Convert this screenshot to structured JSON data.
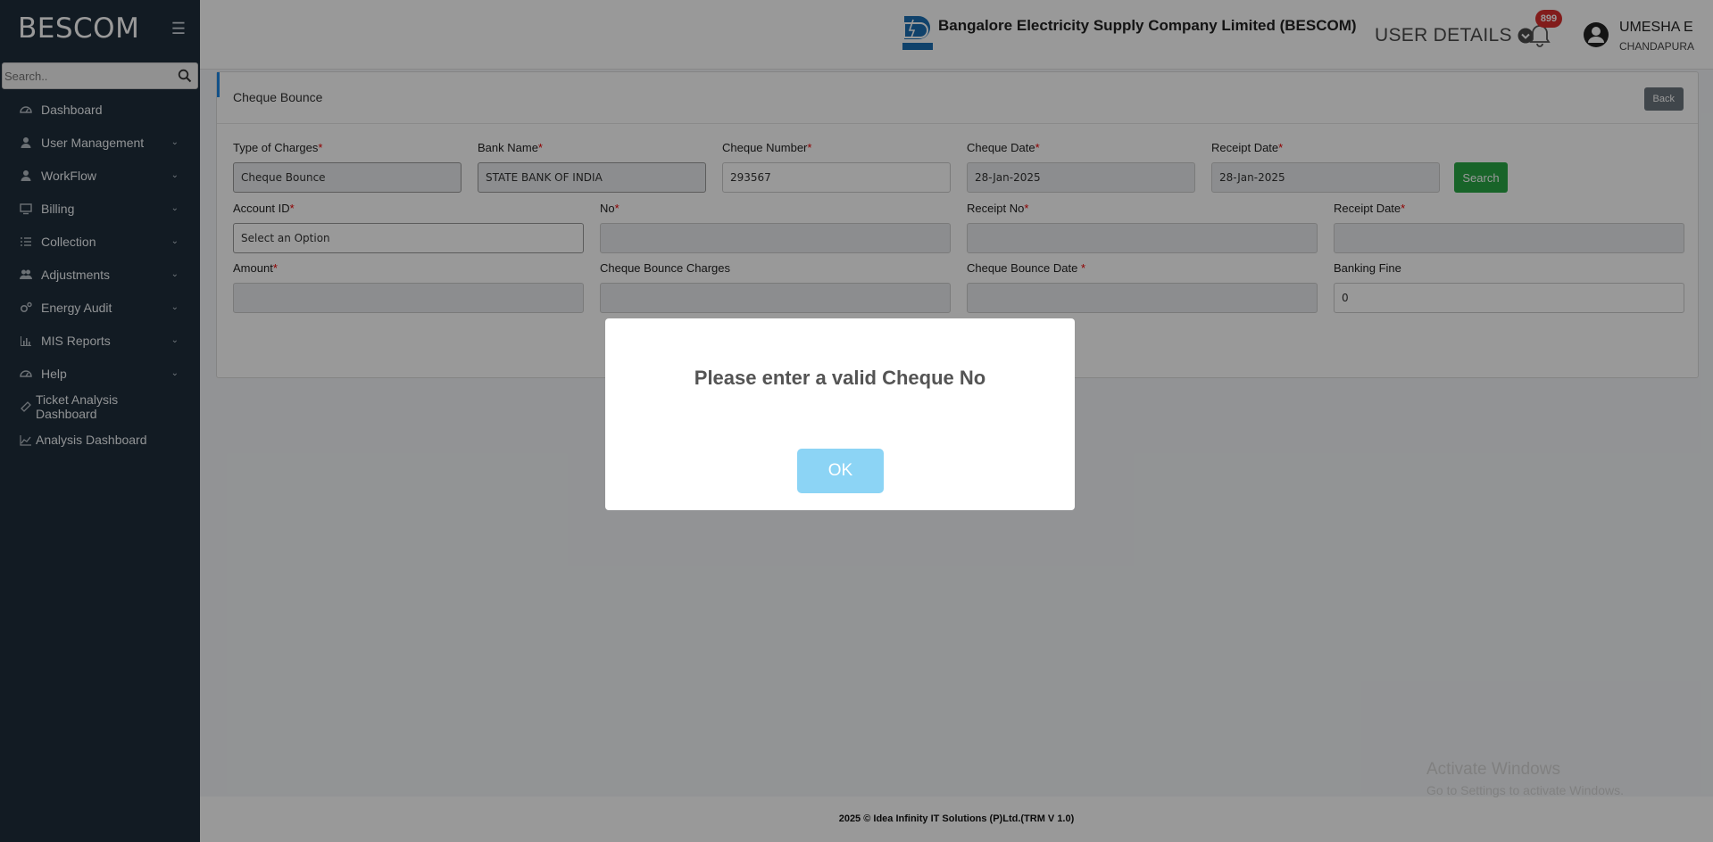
{
  "sidebar": {
    "brand": "BESCOM",
    "search_placeholder": "Search..",
    "items": [
      {
        "label": "Dashboard",
        "icon": "dashboard-icon",
        "has_children": false
      },
      {
        "label": "User Management",
        "icon": "user-icon",
        "has_children": true
      },
      {
        "label": "WorkFlow",
        "icon": "user-icon",
        "has_children": true
      },
      {
        "label": "Billing",
        "icon": "monitor-icon",
        "has_children": true
      },
      {
        "label": "Collection",
        "icon": "list-icon",
        "has_children": true
      },
      {
        "label": "Adjustments",
        "icon": "users-icon",
        "has_children": true
      },
      {
        "label": "Energy Audit",
        "icon": "gears-icon",
        "has_children": true
      },
      {
        "label": "MIS Reports",
        "icon": "bar-chart-icon",
        "has_children": true
      },
      {
        "label": "Help",
        "icon": "dashboard-icon",
        "has_children": true
      },
      {
        "label": "Ticket Analysis Dashboard",
        "icon": "ticket-icon",
        "has_children": false
      },
      {
        "label": "Analysis Dashboard",
        "icon": "line-chart-icon",
        "has_children": false
      }
    ]
  },
  "header": {
    "company": "Bangalore Electricity Supply Company Limited (BESCOM)",
    "user_details_label": "USER DETAILS",
    "notification_count": "899",
    "user_name": "UMESHA E",
    "user_location": "CHANDAPURA"
  },
  "card": {
    "title": "Cheque Bounce",
    "back_label": "Back",
    "search_label": "Search",
    "fields": {
      "type_of_charges": {
        "label": "Type of Charges",
        "value": "Cheque Bounce"
      },
      "bank_name": {
        "label": "Bank Name",
        "value": "STATE BANK OF INDIA"
      },
      "cheque_number": {
        "label": "Cheque Number",
        "value": "293567"
      },
      "cheque_date": {
        "label": "Cheque Date",
        "value": "28-Jan-2025"
      },
      "receipt_date_top": {
        "label": "Receipt Date",
        "value": "28-Jan-2025"
      },
      "account_id": {
        "label": "Account ID",
        "value": "Select an Option"
      },
      "no": {
        "label": "No",
        "value": ""
      },
      "receipt_no": {
        "label": "Receipt No",
        "value": ""
      },
      "receipt_date": {
        "label": "Receipt Date",
        "value": ""
      },
      "amount": {
        "label": "Amount",
        "value": ""
      },
      "cheque_bounce_charges": {
        "label": "Cheque Bounce Charges",
        "value": ""
      },
      "cheque_bounce_date": {
        "label": "Cheque Bounce Date ",
        "value": ""
      },
      "banking_fine": {
        "label": "Banking Fine",
        "value": "0"
      }
    }
  },
  "modal": {
    "message": "Please enter a valid Cheque No",
    "ok_label": "OK"
  },
  "footer": {
    "text": "2025 © Idea Infinity IT Solutions (P)Ltd.(TRM V 1.0)"
  },
  "watermark": {
    "line1": "Activate Windows",
    "line2": "Go to Settings to activate Windows."
  },
  "colors": {
    "sidebar_bg": "#1e2d3b",
    "accent": "#1e88e5",
    "search_button": "#28a745",
    "back_button": "#6c757d",
    "badge": "#d9302e",
    "ok_button": "#8cd4f5"
  }
}
